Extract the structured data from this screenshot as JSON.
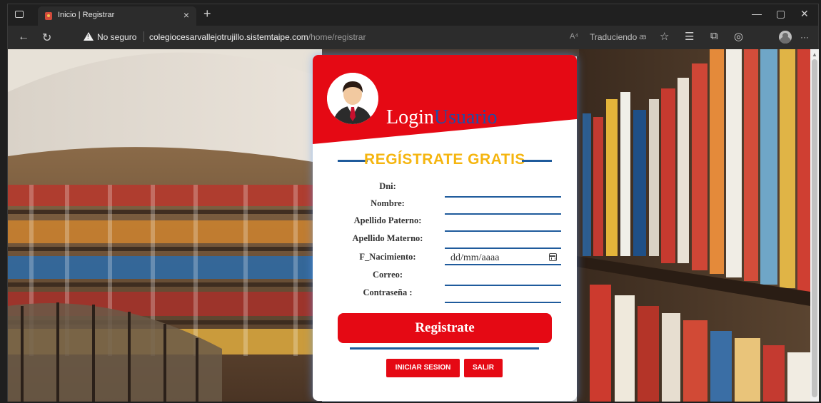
{
  "browser": {
    "tab_title": "Inicio | Registrar",
    "tab_close": "×",
    "new_tab": "+",
    "security_text": "No seguro",
    "url_host": "colegiocesarvallejotrujillo.sistemtaipe.com",
    "url_path": "/home/registrar",
    "read_aloud": "A⁴",
    "translating": "Traduciendo",
    "translate_glyph": "ꜳ",
    "window_controls": {
      "minimize": "—",
      "maximize": "▢",
      "close": "✕"
    },
    "nav": {
      "back": "←",
      "refresh": "↻"
    },
    "toolbar_icons": {
      "favorite": "☆",
      "favorites_list": "☰",
      "collections": "⧉",
      "shield": "◎",
      "more": "···"
    }
  },
  "page": {
    "title_part1": "Login",
    "title_part2": "Usuario",
    "section_title": "REGÍSTRATE GRATIS",
    "fields": {
      "dni": "Dni:",
      "nombre": "Nombre:",
      "apellido_paterno": "Apellido Paterno:",
      "apellido_materno": "Apellido Materno:",
      "f_nacimiento": "F_Nacimiento:",
      "correo": "Correo:",
      "contrasena": "Contraseña :"
    },
    "date_placeholder": "dd/mm/aaaa",
    "register_button": "Registrate",
    "login_button": "INICIAR SESION",
    "exit_button": "SALIR"
  },
  "colors": {
    "accent_red": "#e50914",
    "accent_blue": "#1f5b9c",
    "title_yellow": "#f5b50f"
  }
}
